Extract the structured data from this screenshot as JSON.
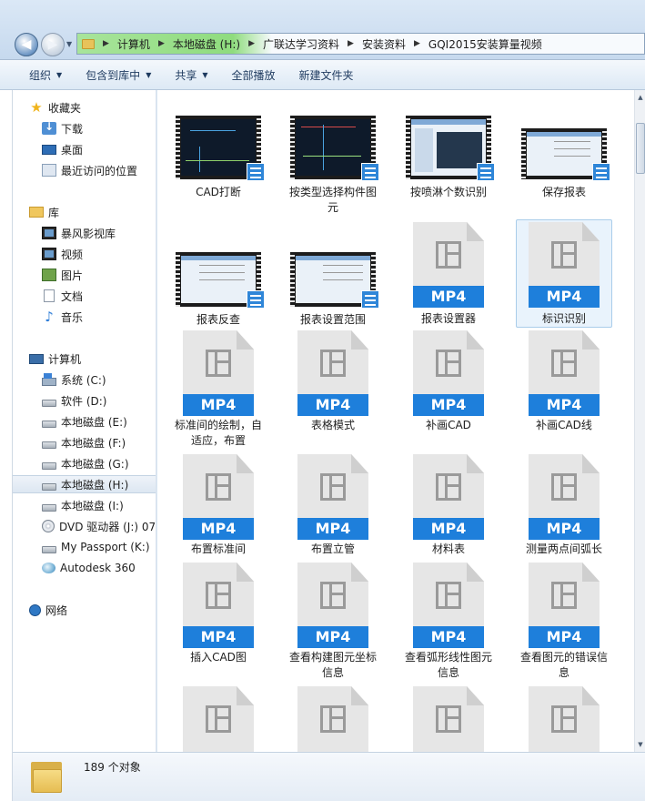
{
  "address": {
    "crumbs": [
      "计算机",
      "本地磁盘 (H:)",
      "广联达学习资料",
      "安装资料",
      "GQI2015安装算量视频"
    ]
  },
  "toolbar": {
    "organize": "组织",
    "include_library": "包含到库中",
    "share": "共享",
    "play_all": "全部播放",
    "new_folder": "新建文件夹"
  },
  "nav": {
    "favorites": "收藏夹",
    "downloads": "下载",
    "desktop": "桌面",
    "recent": "最近访问的位置",
    "libraries": "库",
    "storm_library": "暴风影视库",
    "videos": "视频",
    "pictures": "图片",
    "documents": "文档",
    "music": "音乐",
    "computer": "计算机",
    "drive_c": "系统 (C:)",
    "drive_d": "软件 (D:)",
    "drive_e": "本地磁盘 (E:)",
    "drive_f": "本地磁盘 (F:)",
    "drive_g": "本地磁盘 (G:)",
    "drive_h": "本地磁盘 (H:)",
    "drive_i": "本地磁盘 (I:)",
    "drive_j": "DVD 驱动器 (J:) 07",
    "drive_k": "My Passport (K:)",
    "autodesk": "Autodesk 360",
    "network": "网络"
  },
  "files": {
    "f1": "CAD打断",
    "f2": "按类型选择构件图元",
    "f3": "按喷淋个数识别",
    "f4": "保存报表",
    "f5": "报表反查",
    "f6": "报表设置范围",
    "f7": "报表设置器",
    "f8": "标识识别",
    "f9": "标准间的绘制，自适应，布置",
    "f10": "表格模式",
    "f11": "补画CAD",
    "f12": "补画CAD线",
    "f13": "布置标准间",
    "f14": "布置立管",
    "f15": "材料表",
    "f16": "测量两点间弧长",
    "f17": "插入CAD图",
    "f18": "查看构建图元坐标信息",
    "f19": "查看弧形线性图元信息",
    "f20": "查看图元的错误信息",
    "badge": "MP4"
  },
  "status": {
    "count": "189 个对象"
  }
}
